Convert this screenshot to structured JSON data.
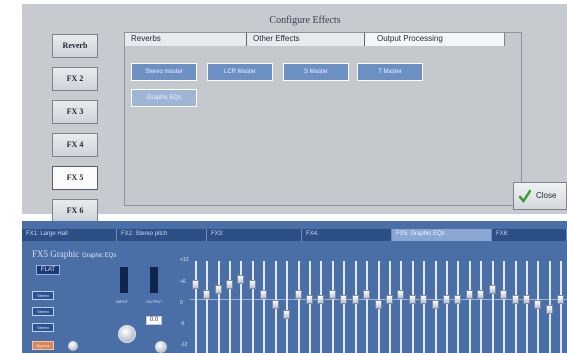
{
  "dialog": {
    "title": "Configure Effects",
    "fx_buttons": [
      {
        "label": "Reverb",
        "active": false
      },
      {
        "label": "FX 2",
        "active": false
      },
      {
        "label": "FX 3",
        "active": false
      },
      {
        "label": "FX 4",
        "active": false
      },
      {
        "label": "FX 5",
        "active": true
      },
      {
        "label": "FX 6",
        "active": false
      }
    ],
    "tabs": [
      "Reverbs",
      "Other Effects",
      "Output Processing"
    ],
    "active_tab": "Output Processing",
    "effect_buttons": [
      "Stereo master",
      "LCR Master",
      "S Master",
      "T Master",
      "Graphic EQs"
    ],
    "close_label": "Close"
  },
  "processor": {
    "strip_tabs": [
      "FX1: Large Hall",
      "FX2: Stereo pitch",
      "FX3:",
      "FX4:",
      "FX5: Graphic EQs",
      "FX6:"
    ],
    "selected_strip": "FX5: Graphic EQs",
    "header": "FX5 Graphic",
    "flat_label": "FLAT",
    "graph_label": "Graphic EQs",
    "side_buttons": [
      "Stereo",
      "Stereo",
      "Stereo",
      "Bypass"
    ],
    "meter_labels": [
      "INPUT",
      "OUTPUT"
    ],
    "gain_value": "0.0",
    "scale_labels": [
      "+12",
      "+6",
      "0",
      "-6",
      "-12"
    ],
    "eq_band_gains": [
      3,
      1,
      2,
      3,
      4,
      3,
      1,
      -1,
      -3,
      1,
      0,
      0,
      1,
      0,
      0,
      1,
      -1,
      0,
      1,
      0,
      0,
      -1,
      0,
      0,
      1,
      1,
      2,
      1,
      0,
      0,
      -1,
      -2,
      0
    ]
  },
  "colors": {
    "dialog_bg": "#c7cbd0",
    "accent_blue": "#6c8fc4",
    "processor_bg": "#4a6ea6",
    "strip_bg": "#214274",
    "close_check": "#3d9a3a"
  }
}
